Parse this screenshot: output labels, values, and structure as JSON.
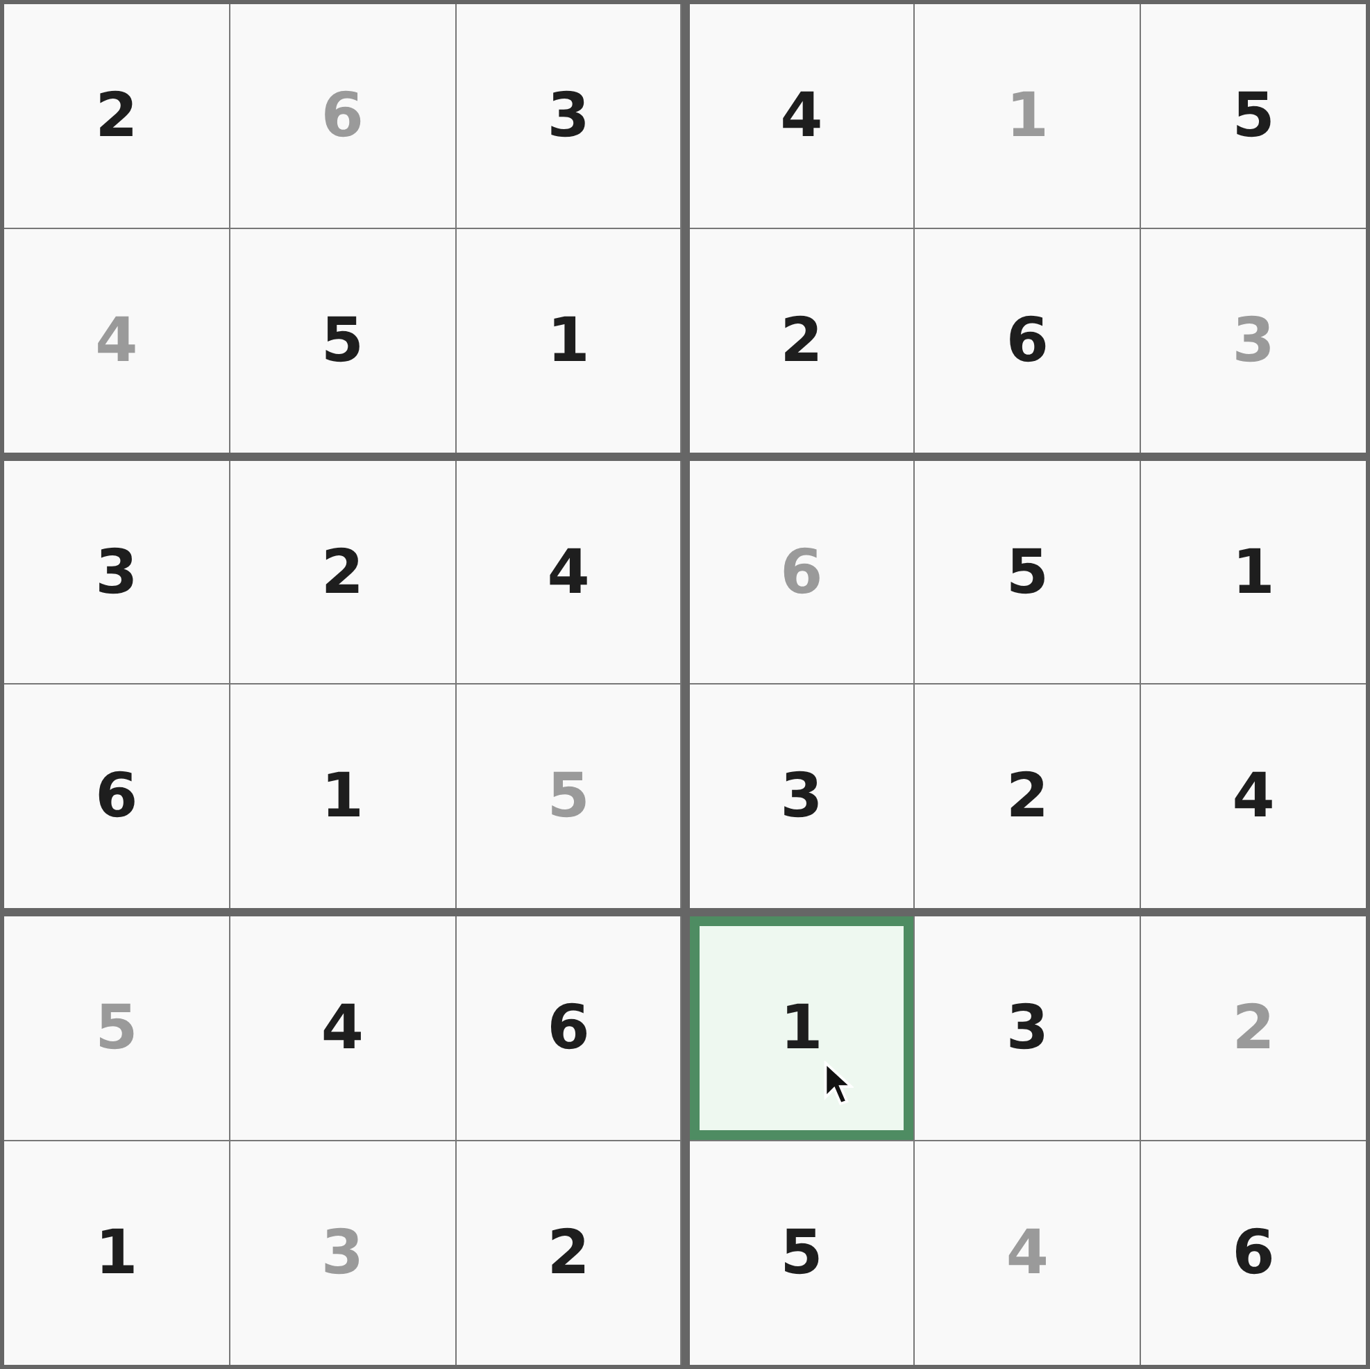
{
  "grid": {
    "rows": [
      {
        "cells": [
          {
            "value": "2",
            "given": true,
            "selected": false
          },
          {
            "value": "6",
            "given": false,
            "selected": false
          },
          {
            "value": "3",
            "given": true,
            "selected": false
          },
          {
            "value": "4",
            "given": true,
            "selected": false
          },
          {
            "value": "1",
            "given": false,
            "selected": false
          },
          {
            "value": "5",
            "given": true,
            "selected": false
          }
        ]
      },
      {
        "cells": [
          {
            "value": "4",
            "given": false,
            "selected": false
          },
          {
            "value": "5",
            "given": true,
            "selected": false
          },
          {
            "value": "1",
            "given": true,
            "selected": false
          },
          {
            "value": "2",
            "given": true,
            "selected": false
          },
          {
            "value": "6",
            "given": true,
            "selected": false
          },
          {
            "value": "3",
            "given": false,
            "selected": false
          }
        ]
      },
      {
        "cells": [
          {
            "value": "3",
            "given": true,
            "selected": false
          },
          {
            "value": "2",
            "given": true,
            "selected": false
          },
          {
            "value": "4",
            "given": true,
            "selected": false
          },
          {
            "value": "6",
            "given": false,
            "selected": false
          },
          {
            "value": "5",
            "given": true,
            "selected": false
          },
          {
            "value": "1",
            "given": true,
            "selected": false
          }
        ]
      },
      {
        "cells": [
          {
            "value": "6",
            "given": true,
            "selected": false
          },
          {
            "value": "1",
            "given": true,
            "selected": false
          },
          {
            "value": "5",
            "given": false,
            "selected": false
          },
          {
            "value": "3",
            "given": true,
            "selected": false
          },
          {
            "value": "2",
            "given": true,
            "selected": false
          },
          {
            "value": "4",
            "given": true,
            "selected": false
          }
        ]
      },
      {
        "cells": [
          {
            "value": "5",
            "given": false,
            "selected": false
          },
          {
            "value": "4",
            "given": true,
            "selected": false
          },
          {
            "value": "6",
            "given": true,
            "selected": false
          },
          {
            "value": "1",
            "given": true,
            "selected": true
          },
          {
            "value": "3",
            "given": true,
            "selected": false
          },
          {
            "value": "2",
            "given": false,
            "selected": false
          }
        ]
      },
      {
        "cells": [
          {
            "value": "1",
            "given": true,
            "selected": false
          },
          {
            "value": "3",
            "given": false,
            "selected": false
          },
          {
            "value": "2",
            "given": true,
            "selected": false
          },
          {
            "value": "5",
            "given": true,
            "selected": false
          },
          {
            "value": "4",
            "given": false,
            "selected": false
          },
          {
            "value": "6",
            "given": true,
            "selected": false
          }
        ]
      }
    ]
  }
}
